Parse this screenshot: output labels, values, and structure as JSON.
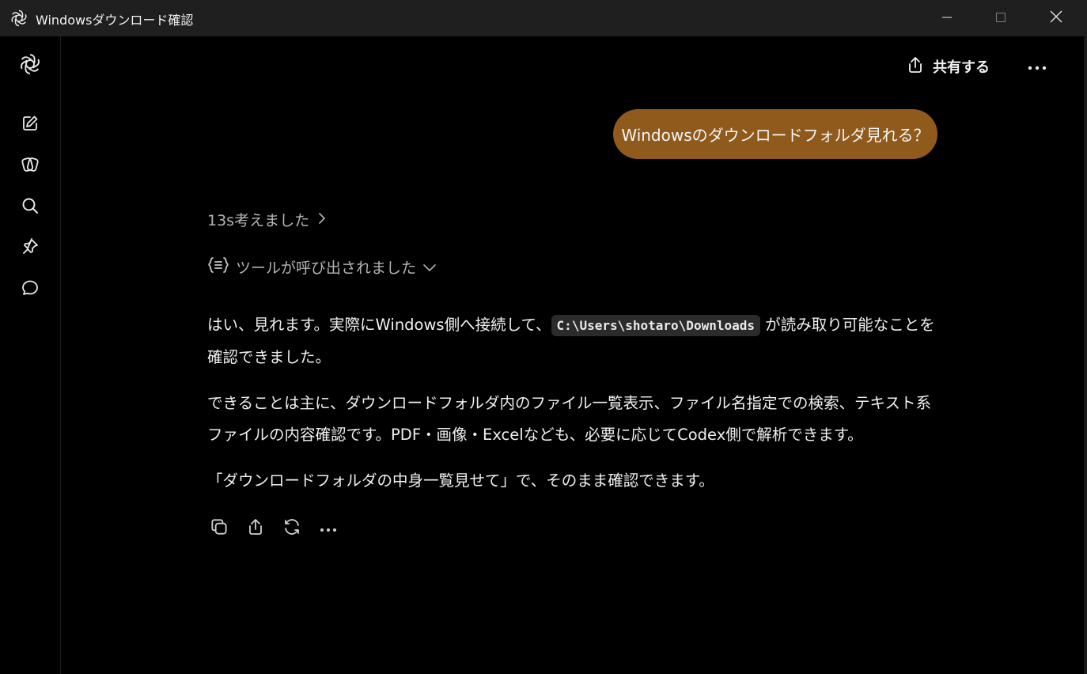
{
  "window": {
    "title": "Windowsダウンロード確認",
    "minimize_label": "Minimize",
    "maximize_label": "Maximize",
    "close_label": "Close"
  },
  "sidebar": {
    "items": [
      {
        "icon": "chatgpt-logo-icon"
      },
      {
        "icon": "new-chat-icon"
      },
      {
        "icon": "gpts-icon"
      },
      {
        "icon": "search-icon"
      },
      {
        "icon": "pin-icon"
      },
      {
        "icon": "chat-bubble-icon"
      }
    ]
  },
  "header": {
    "share_label": "共有する"
  },
  "conversation": {
    "user_message": "Windowsのダウンロードフォルダ見れる？",
    "thought_label": "13s考えました",
    "tool_label": "ツールが呼び出されました",
    "answer": {
      "p1_before": "はい、見れます。実際にWindows側へ接続して、",
      "p1_code": "C:\\Users\\shotaro\\Downloads",
      "p1_after": " が読み取り可能なことを確認できました。",
      "p2": "できることは主に、ダウンロードフォルダ内のファイル一覧表示、ファイル名指定での検索、テキスト系ファイルの内容確認です。PDF・画像・Excelなども、必要に応じてCodex側で解析できます。",
      "p3": "「ダウンロードフォルダの中身一覧見せて」で、そのまま確認できます。"
    }
  },
  "colors": {
    "background": "#000000",
    "titlebar": "#1f1f1f",
    "user_bubble": "#8f5a1c",
    "muted_text": "#b4b4b4",
    "code_bg": "#2b2b2b"
  }
}
